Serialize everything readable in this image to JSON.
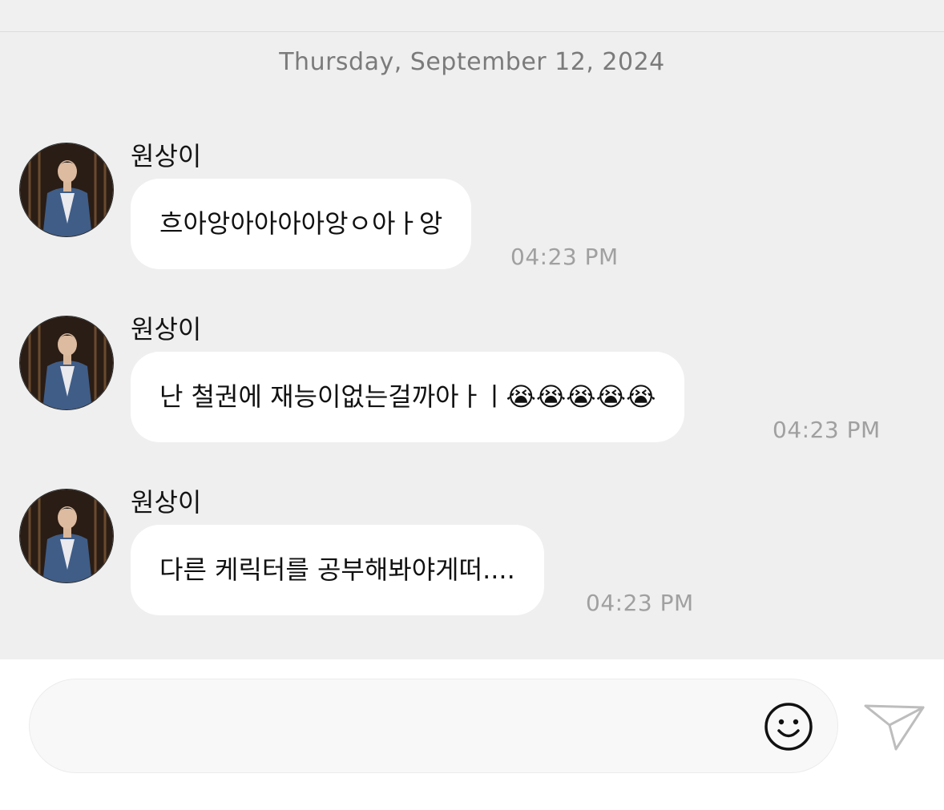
{
  "conversation": {
    "date_header": "Thursday, September 12, 2024",
    "messages": [
      {
        "sender": "원상이",
        "text": "흐아앙아아아아앙ㅇ아ㅏ앙",
        "time": "04:23 PM"
      },
      {
        "sender": "원상이",
        "text": "난 철권에 재능이없는걸까아ㅏㅣ😭😭😭😭😭",
        "time": "04:23 PM"
      },
      {
        "sender": "원상이",
        "text": "다른 케릭터를 공부해봐야게떠....",
        "time": "04:23 PM"
      }
    ]
  },
  "composer": {
    "placeholder": "",
    "emoji_icon": "smiley-icon",
    "send_icon": "paper-plane-icon"
  },
  "colors": {
    "chat_background": "#efefef",
    "bubble": "#ffffff",
    "timestamp": "#a0a0a0"
  }
}
